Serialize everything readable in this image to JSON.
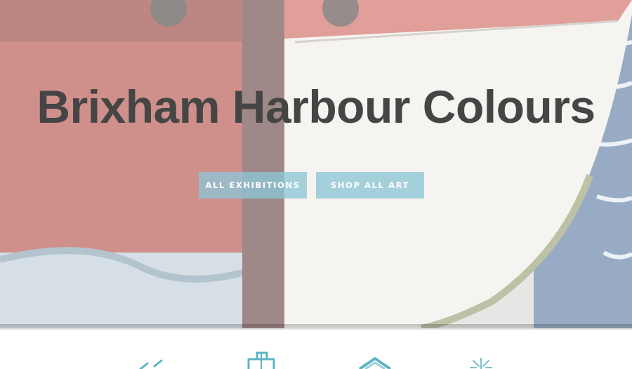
{
  "hero": {
    "title": "Brixham Harbour Colours",
    "buttons": {
      "exhibitions_label": "ALL EXHIBITIONS",
      "shop_label": "SHOP ALL ART"
    }
  },
  "colors": {
    "accent": "#8dc5d6",
    "title_text": "#454545",
    "hull_red": "#b5443c",
    "hull_white": "#f1efe9",
    "water": "#4d6f99"
  },
  "features": {
    "icons": [
      "easel-icon",
      "shopping-bag-icon",
      "home-icon",
      "sparkle-icon"
    ]
  }
}
